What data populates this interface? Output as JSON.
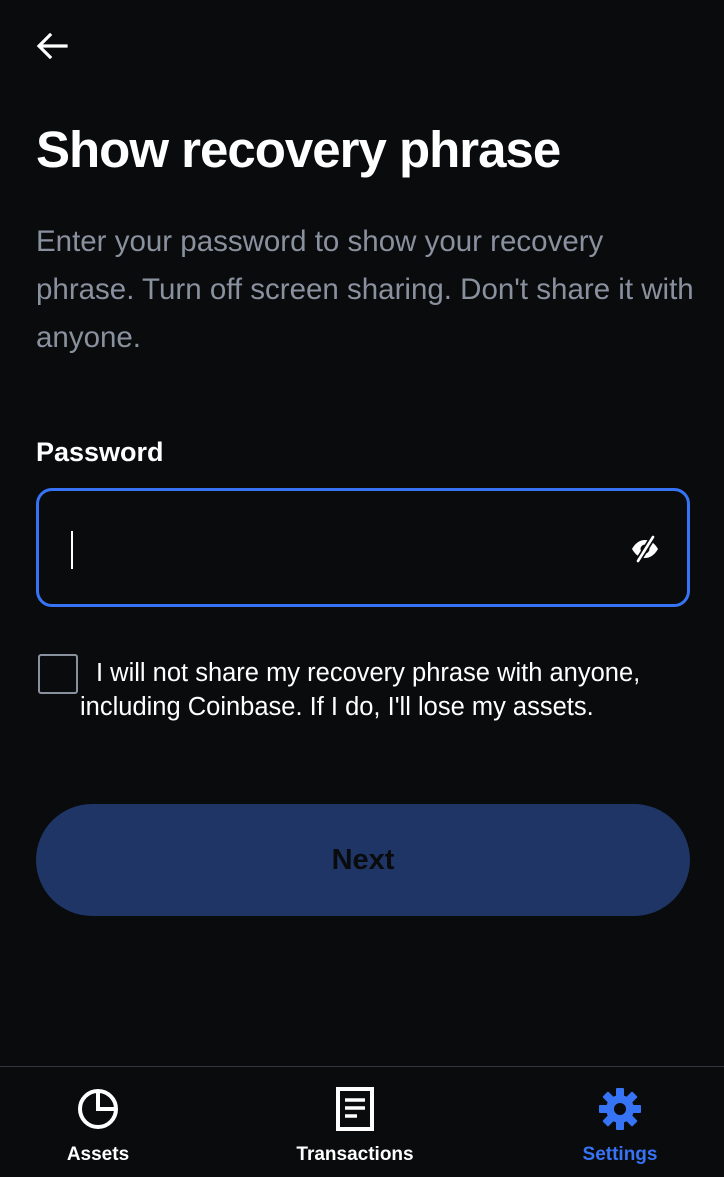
{
  "header": {
    "back_icon": "arrow-left-icon",
    "title": "Show recovery phrase",
    "description": "Enter your password to show your recovery phrase. Turn off screen sharing. Don't share it with anyone."
  },
  "form": {
    "password_label": "Password",
    "password_value": "",
    "visibility_icon": "eye-off-icon",
    "field_border_color": "#3773f5",
    "consent_checked": false,
    "consent_text": "I will not share my recovery phrase with anyone, including Coinbase. If I do, I'll lose my assets.",
    "next_label": "Next",
    "next_button_color": "#1e3566"
  },
  "tabbar": {
    "active_color": "#3773f5",
    "tabs": [
      {
        "label": "Assets",
        "icon": "pie-chart-icon",
        "active": false
      },
      {
        "label": "Transactions",
        "icon": "document-icon",
        "active": false
      },
      {
        "label": "Settings",
        "icon": "gear-icon",
        "active": true
      }
    ]
  }
}
